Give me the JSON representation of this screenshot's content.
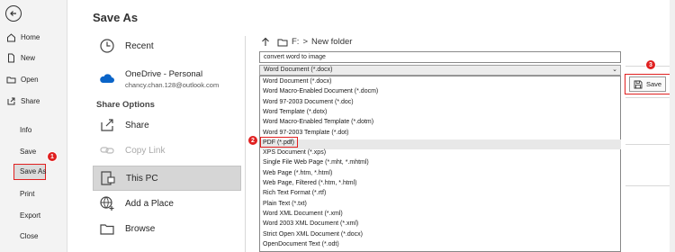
{
  "nav": {
    "items": [
      {
        "label": "Home",
        "icon": "home-icon"
      },
      {
        "label": "New",
        "icon": "new-document-icon"
      },
      {
        "label": "Open",
        "icon": "folder-open-icon"
      },
      {
        "label": "Share",
        "icon": "share-icon"
      }
    ],
    "plain_items": [
      "Info",
      "Save",
      "Save As",
      "Print",
      "Export",
      "Close"
    ],
    "active": "Save As"
  },
  "page_title": "Save As",
  "locations": {
    "recent": "Recent",
    "onedrive_title": "OneDrive - Personal",
    "onedrive_email": "chancy.chan.128@outlook.com",
    "share_options_label": "Share Options",
    "share": "Share",
    "copy_link": "Copy Link",
    "this_pc": "This PC",
    "add_place": "Add a Place",
    "browse": "Browse"
  },
  "breadcrumb": {
    "drive": "F:",
    "separator": ">",
    "folder": "New folder"
  },
  "file_name": "convert word to image",
  "file_type_selected": "Word Document (*.docx)",
  "file_type_options": [
    "Word Document (*.docx)",
    "Word Macro-Enabled Document (*.docm)",
    "Word 97-2003 Document (*.doc)",
    "Word Template (*.dotx)",
    "Word Macro-Enabled Template (*.dotm)",
    "Word 97-2003 Template (*.dot)",
    "PDF (*.pdf)",
    "XPS Document (*.xps)",
    "Single File Web Page (*.mht, *.mhtml)",
    "Web Page (*.htm, *.html)",
    "Web Page, Filtered (*.htm, *.html)",
    "Rich Text Format (*.rtf)",
    "Plain Text (*.txt)",
    "Word XML Document (*.xml)",
    "Word 2003 XML Document (*.xml)",
    "Strict Open XML Document (*.docx)",
    "OpenDocument Text (*.odt)"
  ],
  "save_button": "Save",
  "step_badges": [
    "1",
    "2",
    "3"
  ],
  "colors": {
    "highlight_red": "#e02020",
    "onedrive_blue": "#0a64c8"
  }
}
